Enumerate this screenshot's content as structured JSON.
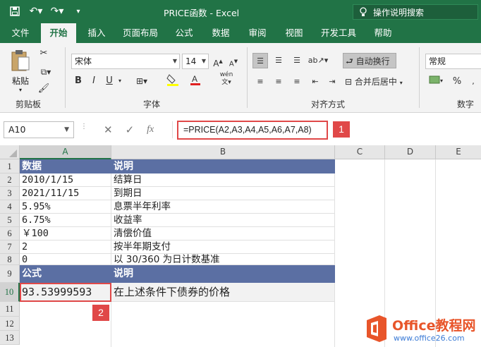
{
  "window": {
    "title": "PRICE函数  -  Excel",
    "tellme": "操作说明搜索"
  },
  "tabs": [
    "文件",
    "开始",
    "插入",
    "页面布局",
    "公式",
    "数据",
    "审阅",
    "视图",
    "开发工具",
    "帮助"
  ],
  "ribbon": {
    "clipboard": {
      "paste": "粘贴",
      "label": "剪贴板"
    },
    "font": {
      "name": "宋体",
      "size": "14",
      "label": "字体",
      "bold": "B",
      "italic": "I",
      "underline": "U"
    },
    "alignment": {
      "wrap": "自动换行",
      "merge": "合并后居中",
      "label": "对齐方式"
    },
    "number": {
      "format": "常规",
      "percent": "%",
      "label": "数字"
    }
  },
  "formula_bar": {
    "name_box": "A10",
    "fx": "fx",
    "formula": "=PRICE(A2,A3,A4,A5,A6,A7,A8)",
    "badge": "1"
  },
  "columns": [
    "A",
    "B",
    "C",
    "D",
    "E"
  ],
  "rows": [
    "1",
    "2",
    "3",
    "4",
    "5",
    "6",
    "7",
    "8",
    "9",
    "10",
    "11",
    "12",
    "13"
  ],
  "cells": {
    "r1": [
      "数据",
      "说明"
    ],
    "r2": [
      "2010/1/15",
      "结算日"
    ],
    "r3": [
      "2021/11/15",
      "到期日"
    ],
    "r4": [
      "5.95%",
      "息票半年利率"
    ],
    "r5": [
      "6.75%",
      "收益率"
    ],
    "r6": [
      "￥100",
      "清偿价值"
    ],
    "r7": [
      "2",
      "按半年期支付"
    ],
    "r8": [
      "0",
      "以 30/360 为日计数基准"
    ],
    "r9": [
      "公式",
      "说明"
    ],
    "r10": [
      "93.53999593",
      "在上述条件下债券的价格"
    ]
  },
  "cell_badge": "2",
  "watermark": {
    "name": "Office教程网",
    "url": "www.office26.com"
  },
  "colors": {
    "excel_green": "#217346",
    "header_blue": "#5b6fa3",
    "highlight_red": "#e04848"
  }
}
